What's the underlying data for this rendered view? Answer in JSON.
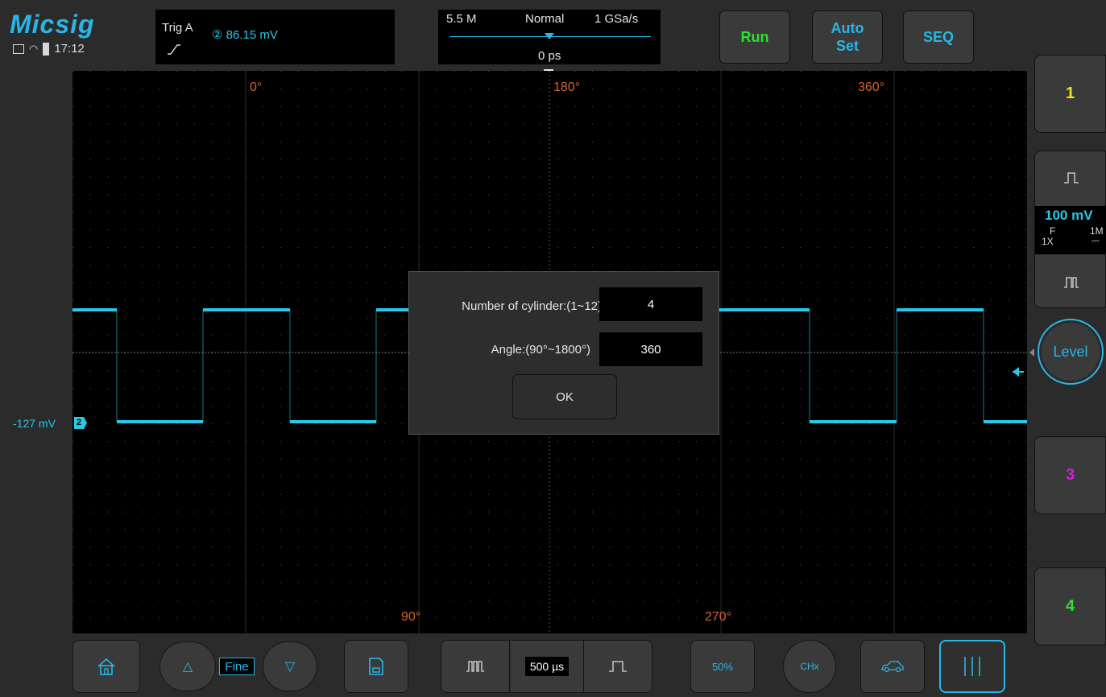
{
  "brand": "Micsig",
  "status": {
    "time": "17:12"
  },
  "trigger": {
    "label": "Trig  A",
    "channel_marker": "②",
    "level": "86.15 mV"
  },
  "timebase": {
    "memory_depth": "5.5 M",
    "mode": "Normal",
    "sample_rate": "1 GSa/s",
    "offset": "0 ps",
    "trigger_marker": "T"
  },
  "top_buttons": {
    "run": "Run",
    "auto_set_line1": "Auto",
    "auto_set_line2": "Set",
    "seq": "SEQ"
  },
  "phase_labels": {
    "p0": "0°",
    "p180": "180°",
    "p360": "360°",
    "p90": "90°",
    "p270": "270°"
  },
  "channel2": {
    "offset": "-127 mV",
    "marker": "2",
    "scale": "100 mV",
    "coupling": "F",
    "impedance": "1M",
    "probe": "1X",
    "dc_symbol": "⎓"
  },
  "right_buttons": {
    "ch1": "1",
    "level": "Level",
    "ch3": "3",
    "ch4": "4"
  },
  "dialog": {
    "cylinders_label": "Number of cylinder:(1~12)",
    "cylinders_value": "4",
    "angle_label": "Angle:(90°~1800°)",
    "angle_value": "360",
    "ok_label": "OK"
  },
  "bottom": {
    "fine": "Fine",
    "timebase": "500 µs",
    "fifty_percent": "50%",
    "chx": "CHx"
  },
  "colors": {
    "accent": "#27b7e6",
    "ch1": "#f5e21a",
    "ch2": "#27c9e8",
    "ch3": "#d21fd2",
    "ch4": "#2fe12f",
    "run": "#2fe12f",
    "phase": "#d5632f"
  }
}
